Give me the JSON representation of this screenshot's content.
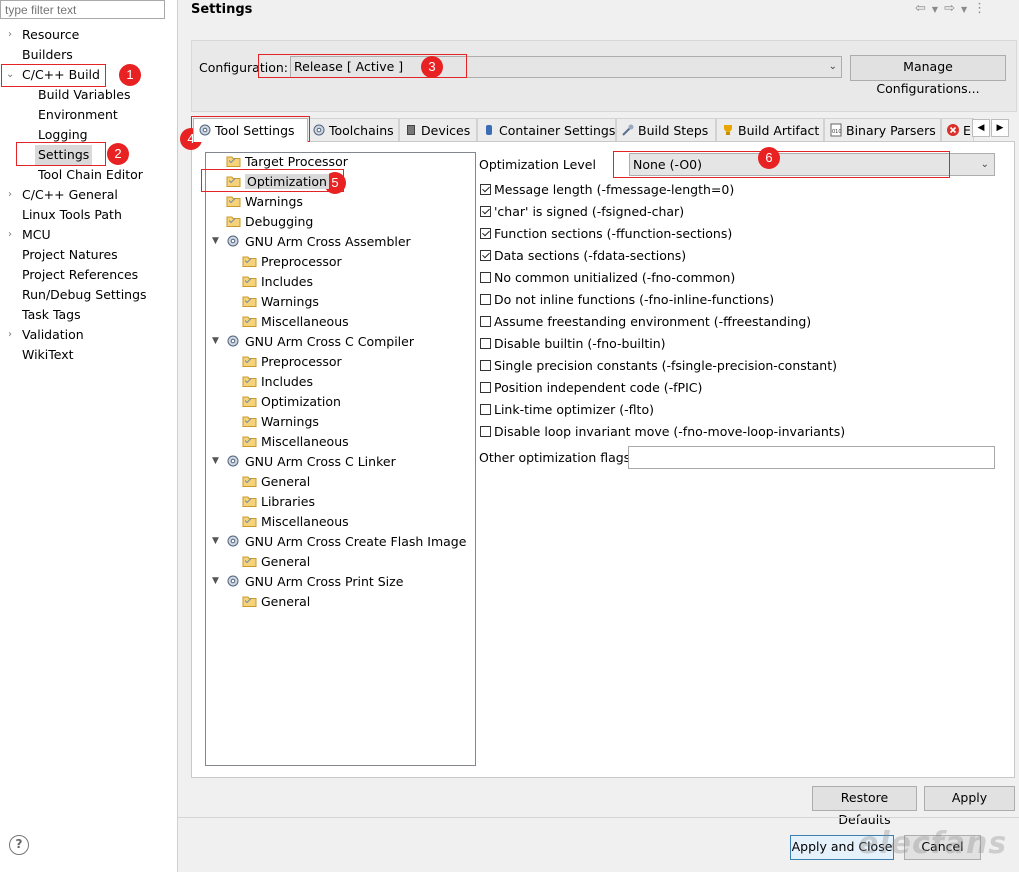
{
  "filter": {
    "placeholder": "type filter text"
  },
  "nav": {
    "items": [
      {
        "label": "Resource"
      },
      {
        "label": "Builders"
      },
      {
        "label": "C/C++ Build"
      },
      {
        "label": "Build Variables"
      },
      {
        "label": "Environment"
      },
      {
        "label": "Logging"
      },
      {
        "label": "Settings"
      },
      {
        "label": "Tool Chain Editor"
      },
      {
        "label": "C/C++ General"
      },
      {
        "label": "Linux Tools Path"
      },
      {
        "label": "MCU"
      },
      {
        "label": "Project Natures"
      },
      {
        "label": "Project References"
      },
      {
        "label": "Run/Debug Settings"
      },
      {
        "label": "Task Tags"
      },
      {
        "label": "Validation"
      },
      {
        "label": "WikiText"
      }
    ]
  },
  "header": {
    "title": "Settings"
  },
  "config": {
    "label": "Configuration:",
    "value": "Release  [ Active ]",
    "manage_label": "Manage Configurations..."
  },
  "tabs": [
    {
      "label": "Tool Settings"
    },
    {
      "label": "Toolchains"
    },
    {
      "label": "Devices"
    },
    {
      "label": "Container Settings"
    },
    {
      "label": "Build Steps"
    },
    {
      "label": "Build Artifact"
    },
    {
      "label": "Binary Parsers"
    },
    {
      "label": "E"
    }
  ],
  "tree": [
    {
      "label": "Target Processor"
    },
    {
      "label": "Optimization"
    },
    {
      "label": "Warnings"
    },
    {
      "label": "Debugging"
    },
    {
      "label": "GNU Arm Cross Assembler"
    },
    {
      "label": "Preprocessor"
    },
    {
      "label": "Includes"
    },
    {
      "label": "Warnings"
    },
    {
      "label": "Miscellaneous"
    },
    {
      "label": "GNU Arm Cross C Compiler"
    },
    {
      "label": "Preprocessor"
    },
    {
      "label": "Includes"
    },
    {
      "label": "Optimization"
    },
    {
      "label": "Warnings"
    },
    {
      "label": "Miscellaneous"
    },
    {
      "label": "GNU Arm Cross C Linker"
    },
    {
      "label": "General"
    },
    {
      "label": "Libraries"
    },
    {
      "label": "Miscellaneous"
    },
    {
      "label": "GNU Arm Cross Create Flash Image"
    },
    {
      "label": "General"
    },
    {
      "label": "GNU Arm Cross Print Size"
    },
    {
      "label": "General"
    }
  ],
  "options": {
    "level_label": "Optimization Level",
    "level_value": "None (-O0)",
    "checks": [
      {
        "label": "Message length (-fmessage-length=0)",
        "checked": true
      },
      {
        "label": "'char' is signed (-fsigned-char)",
        "checked": true
      },
      {
        "label": "Function sections (-ffunction-sections)",
        "checked": true
      },
      {
        "label": "Data sections (-fdata-sections)",
        "checked": true
      },
      {
        "label": "No common unitialized (-fno-common)",
        "checked": false
      },
      {
        "label": "Do not inline functions (-fno-inline-functions)",
        "checked": false
      },
      {
        "label": "Assume freestanding environment (-ffreestanding)",
        "checked": false
      },
      {
        "label": "Disable builtin (-fno-builtin)",
        "checked": false
      },
      {
        "label": "Single precision constants (-fsingle-precision-constant)",
        "checked": false
      },
      {
        "label": "Position independent code (-fPIC)",
        "checked": false
      },
      {
        "label": "Link-time optimizer (-flto)",
        "checked": false
      },
      {
        "label": "Disable loop invariant move (-fno-move-loop-invariants)",
        "checked": false
      }
    ],
    "other_label": "Other optimization flags",
    "other_value": ""
  },
  "buttons": {
    "restore": "Restore Defaults",
    "apply": "Apply",
    "apply_close": "Apply and Close",
    "cancel": "Cancel",
    "help": "?"
  },
  "badges": [
    "1",
    "2",
    "3",
    "4",
    "5",
    "6"
  ],
  "watermark": "elecfans",
  "colors": {
    "annotation": "#e32424",
    "selection": "#d9d9d9"
  }
}
